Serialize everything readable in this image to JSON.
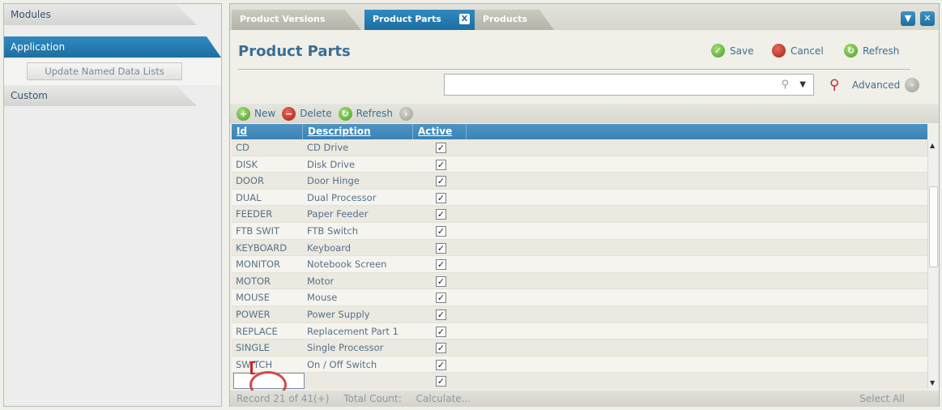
{
  "nav": {
    "modules_label": "Modules",
    "application_label": "Application",
    "update_named_label": "Update Named Data Lists",
    "custom_label": "Custom"
  },
  "tabs": [
    {
      "label": "Product Versions"
    },
    {
      "label": "Product Parts",
      "close": "X"
    },
    {
      "label": "Products"
    }
  ],
  "header": {
    "title": "Product Parts",
    "save_label": "Save",
    "cancel_label": "Cancel",
    "refresh_label": "Refresh",
    "search_placeholder": "",
    "advanced_label": "Advanced"
  },
  "grid_toolbar": {
    "new_label": "New",
    "delete_label": "Delete",
    "refresh_label": "Refresh"
  },
  "columns": {
    "id": "Id",
    "description": "Description",
    "active": "Active"
  },
  "rows": [
    {
      "id": "CD",
      "desc": "CD Drive"
    },
    {
      "id": "DISK",
      "desc": "Disk Drive"
    },
    {
      "id": "DOOR",
      "desc": "Door Hinge"
    },
    {
      "id": "DUAL",
      "desc": "Dual Processor"
    },
    {
      "id": "FEEDER",
      "desc": "Paper Feeder"
    },
    {
      "id": "FTB SWIT",
      "desc": "FTB Switch"
    },
    {
      "id": "KEYBOARD",
      "desc": "Keyboard"
    },
    {
      "id": "MONITOR",
      "desc": "Notebook Screen"
    },
    {
      "id": "MOTOR",
      "desc": "Motor"
    },
    {
      "id": "MOUSE",
      "desc": "Mouse"
    },
    {
      "id": "POWER",
      "desc": "Power Supply"
    },
    {
      "id": "REPLACE",
      "desc": "Replacement Part 1"
    },
    {
      "id": "SINGLE",
      "desc": "Single Processor"
    },
    {
      "id": "SWITCH",
      "desc": "On / Off Switch"
    },
    {
      "id": "",
      "desc": ""
    }
  ],
  "status": {
    "record": "Record 21 of 41(+)",
    "total_count": "Total Count:",
    "calculate": "Calculate...",
    "select_all": "Select All"
  },
  "icons": {
    "check": "✓",
    "dropdown": "▼",
    "scroll_up": "▲",
    "scroll_down": "▼",
    "search": "⚲",
    "window_min": "▼",
    "window_close": "✕"
  }
}
